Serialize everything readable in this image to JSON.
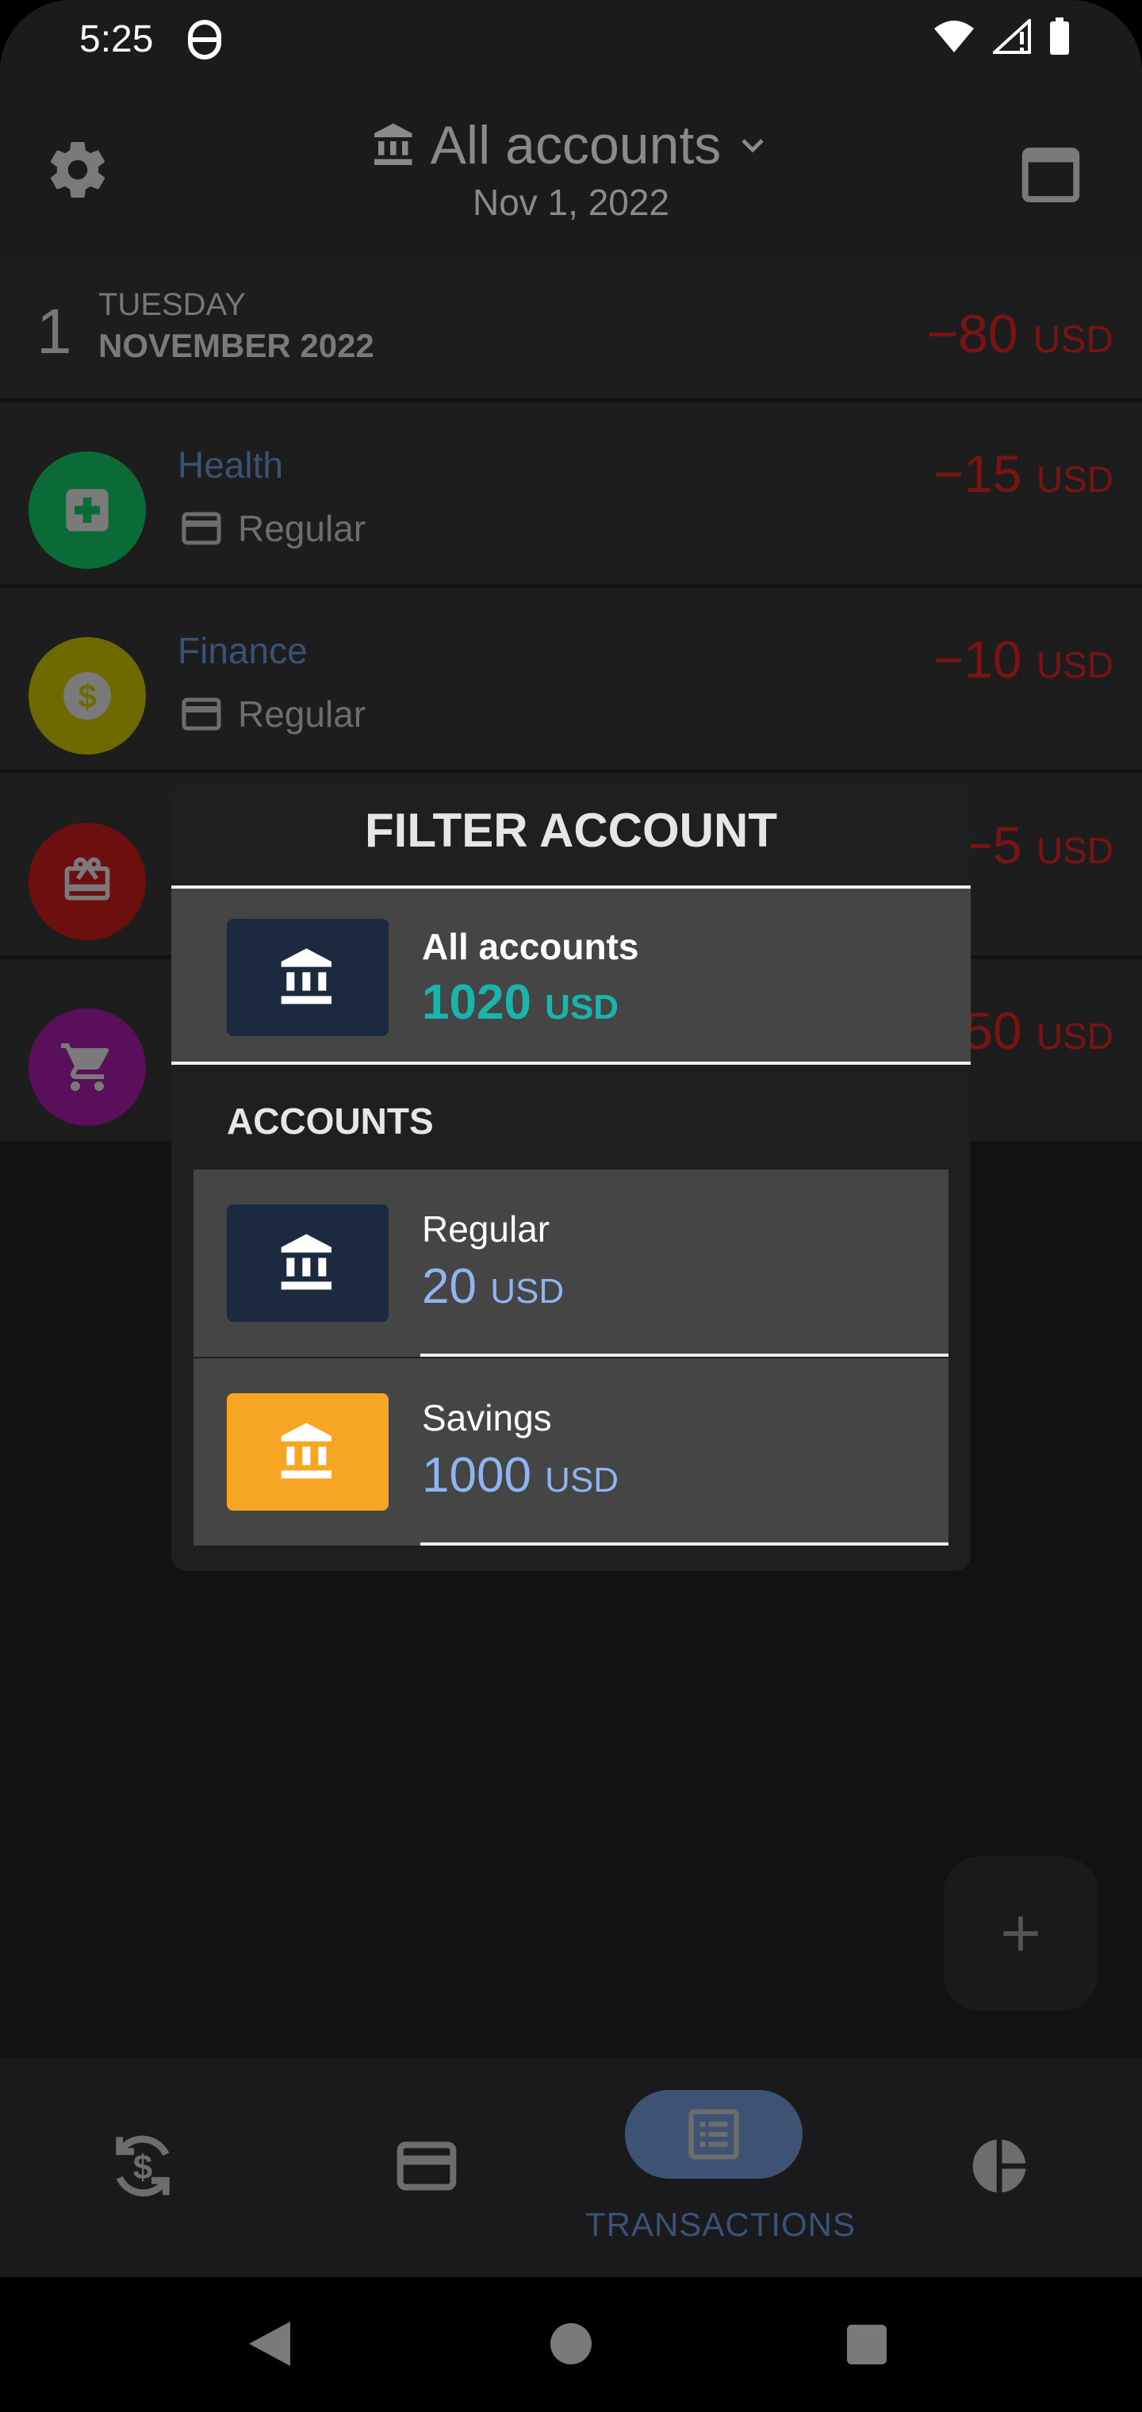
{
  "status_bar": {
    "time": "5:25"
  },
  "header": {
    "title": "All accounts",
    "date": "Nov 1, 2022"
  },
  "day": {
    "number": "1",
    "weekday": "TUESDAY",
    "month": "NOVEMBER 2022",
    "total": "−80",
    "currency": "USD"
  },
  "transactions": [
    {
      "category": "Health",
      "account": "Regular",
      "amount": "−15",
      "currency": "USD",
      "color": "#0b6b37",
      "icon": "medical-cross-icon"
    },
    {
      "category": "Finance",
      "account": "Regular",
      "amount": "−10",
      "currency": "USD",
      "color": "#6e6a00",
      "icon": "dollar-coin-icon"
    },
    {
      "amount": "−5",
      "currency": "USD",
      "color": "#6e0f0f",
      "icon": "gift-icon"
    },
    {
      "amount": "50",
      "currency": "USD",
      "color": "#5a0f5a",
      "icon": "shopping-cart-icon"
    }
  ],
  "modal": {
    "title": "FILTER ACCOUNT",
    "all_accounts": {
      "name": "All accounts",
      "value": "1020",
      "currency": "USD",
      "color": "#19b5ac"
    },
    "section_label": "ACCOUNTS",
    "accounts": [
      {
        "name": "Regular",
        "value": "20",
        "currency": "USD",
        "tile_color": "#1c2a40"
      },
      {
        "name": "Savings",
        "value": "1000",
        "currency": "USD",
        "tile_color": "#f6a623"
      }
    ],
    "value_color": "#8fb4f2"
  },
  "bottom_nav": {
    "items": [
      {
        "icon": "recurring-dollar-icon"
      },
      {
        "icon": "credit-card-icon"
      },
      {
        "icon": "transactions-list-icon",
        "label": "TRANSACTIONS",
        "active": true
      },
      {
        "icon": "pie-chart-icon"
      }
    ]
  },
  "fab": {
    "icon": "plus-icon"
  }
}
